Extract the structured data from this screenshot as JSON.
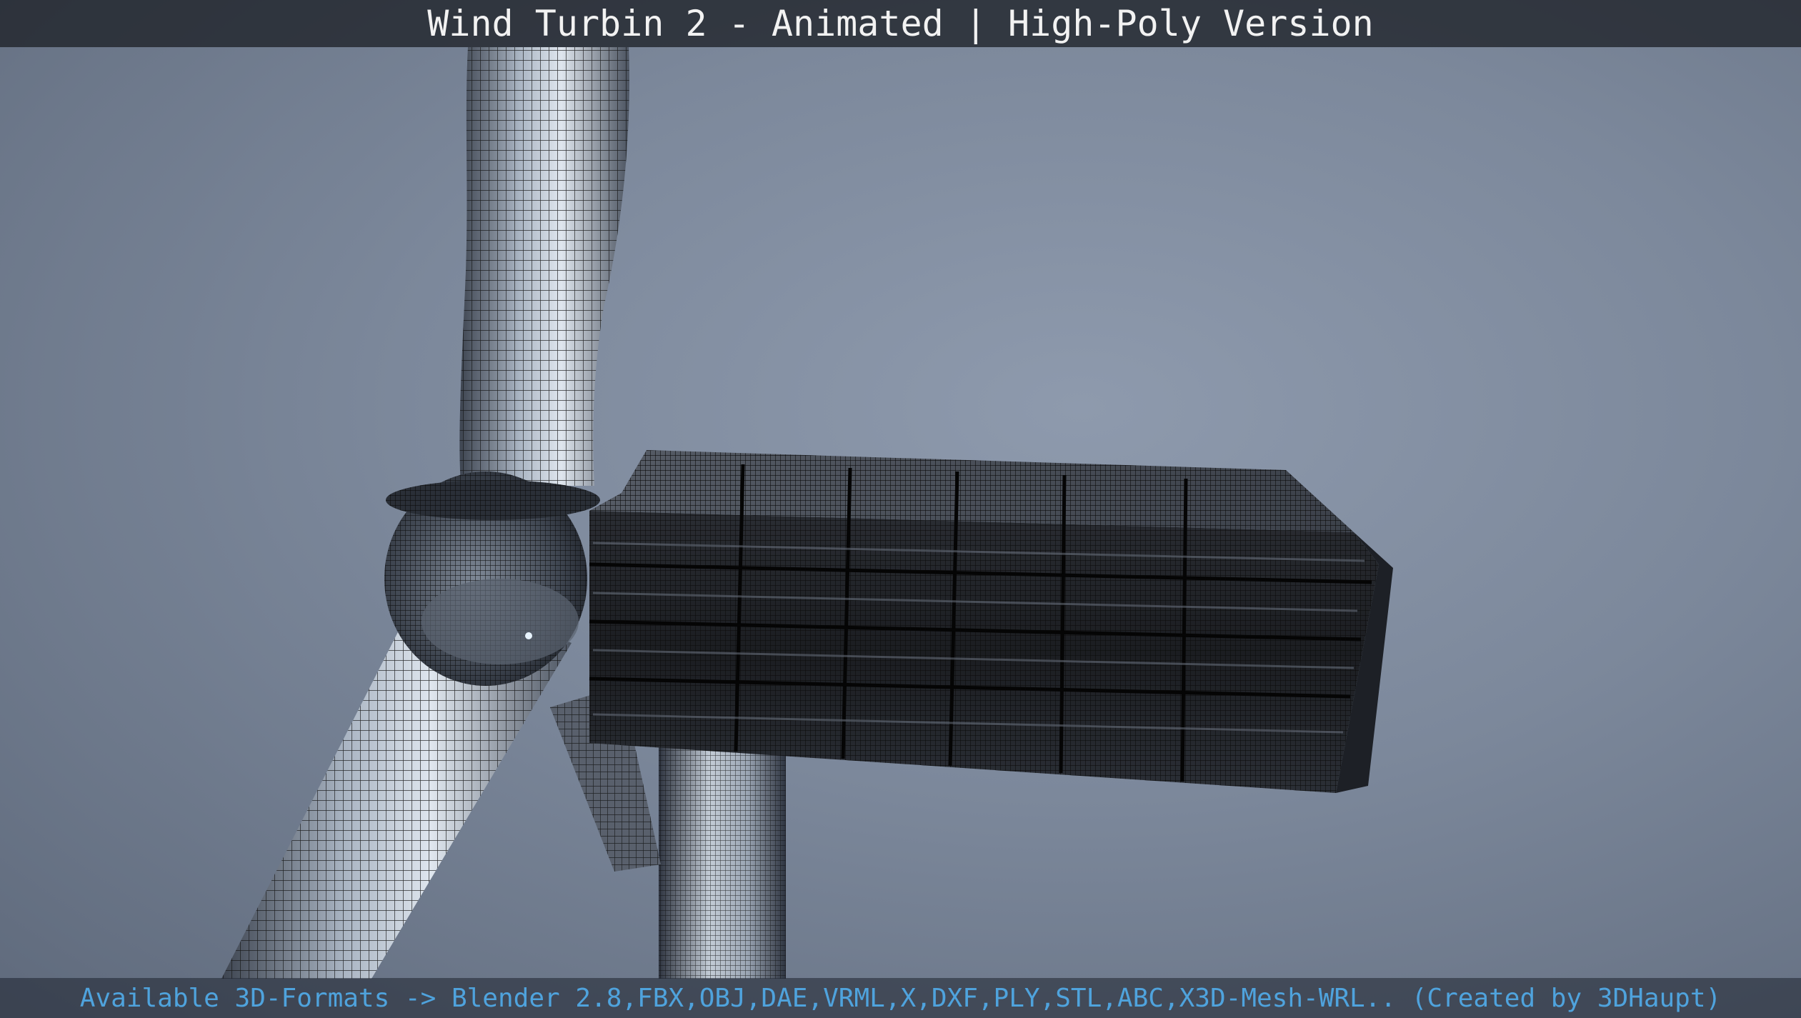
{
  "title": "Wind Turbin 2 - Animated | High-Poly Version",
  "footer": "Available 3D-Formats -> Blender 2.8,FBX,OBJ,DAE,VRML,X,DXF,PLY,STL,ABC,X3D-Mesh-WRL.. (Created by 3DHaupt)",
  "colors": {
    "sky": "#7c889b",
    "title_bar": "#1e2128",
    "title_text": "#f2f2f2",
    "footer_text": "#4fa3dd",
    "mesh_dark": "#151515",
    "metal_light": "#c9d2dc"
  },
  "scene": {
    "subject": "wind-turbine-wireframe",
    "parts": [
      "blade-upper",
      "blade-lower",
      "hub",
      "nacelle",
      "tower"
    ]
  }
}
